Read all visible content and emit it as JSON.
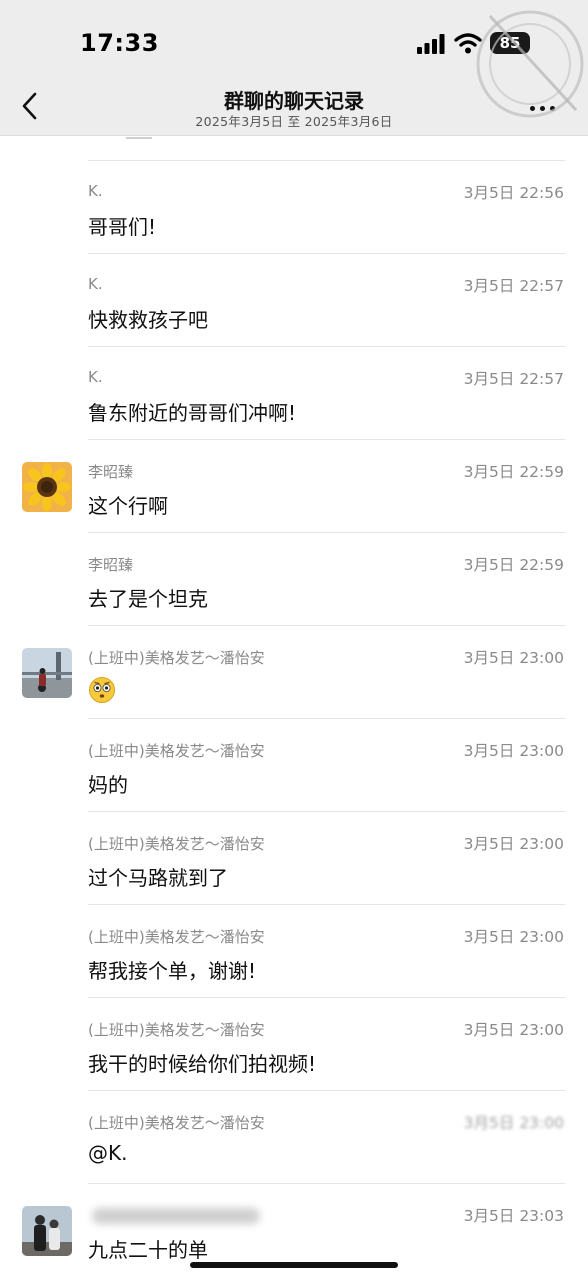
{
  "status_bar": {
    "time": "17:33",
    "battery": "85",
    "icons": [
      "signal-icon",
      "wifi-icon",
      "battery-icon"
    ]
  },
  "header": {
    "title": "群聊的聊天记录",
    "subtitle": "2025年3月5日 至 2025年3月6日",
    "back_icon": "chevron-left-icon",
    "more_icon": "more-dots-icon"
  },
  "messages": [
    {
      "sender": "K.",
      "time": "3月5日 22:56",
      "text": "哥哥们!",
      "avatar": ""
    },
    {
      "sender": "K.",
      "time": "3月5日 22:57",
      "text": "快救救孩子吧",
      "avatar": ""
    },
    {
      "sender": "K.",
      "time": "3月5日 22:57",
      "text": "鲁东附近的哥哥们冲啊!",
      "avatar": ""
    },
    {
      "sender": "李昭臻",
      "time": "3月5日 22:59",
      "text": "这个行啊",
      "avatar": "sunflower-avatar"
    },
    {
      "sender": "李昭臻",
      "time": "3月5日 22:59",
      "text": "去了是个坦克",
      "avatar": ""
    },
    {
      "sender": "(上班中)美格发艺～潘怡安",
      "time": "3月5日 23:00",
      "text": "",
      "avatar": "motorbike-avatar",
      "emoji": "surprised-emoji-icon"
    },
    {
      "sender": "(上班中)美格发艺～潘怡安",
      "time": "3月5日 23:00",
      "text": "妈的",
      "avatar": ""
    },
    {
      "sender": "(上班中)美格发艺～潘怡安",
      "time": "3月5日 23:00",
      "text": "过个马路就到了",
      "avatar": ""
    },
    {
      "sender": "(上班中)美格发艺～潘怡安",
      "time": "3月5日 23:00",
      "text": "帮我接个单，谢谢!",
      "avatar": ""
    },
    {
      "sender": "(上班中)美格发艺～潘怡安",
      "time": "3月5日 23:00",
      "text": "我干的时候给你们拍视频!",
      "avatar": ""
    },
    {
      "sender": "(上班中)美格发艺～潘怡安",
      "time": "3月5日 23:00",
      "text": "@K.",
      "avatar": ""
    },
    {
      "sender": "",
      "time": "3月5日 23:03",
      "text": "九点二十的单",
      "avatar": "people-avatar"
    }
  ]
}
